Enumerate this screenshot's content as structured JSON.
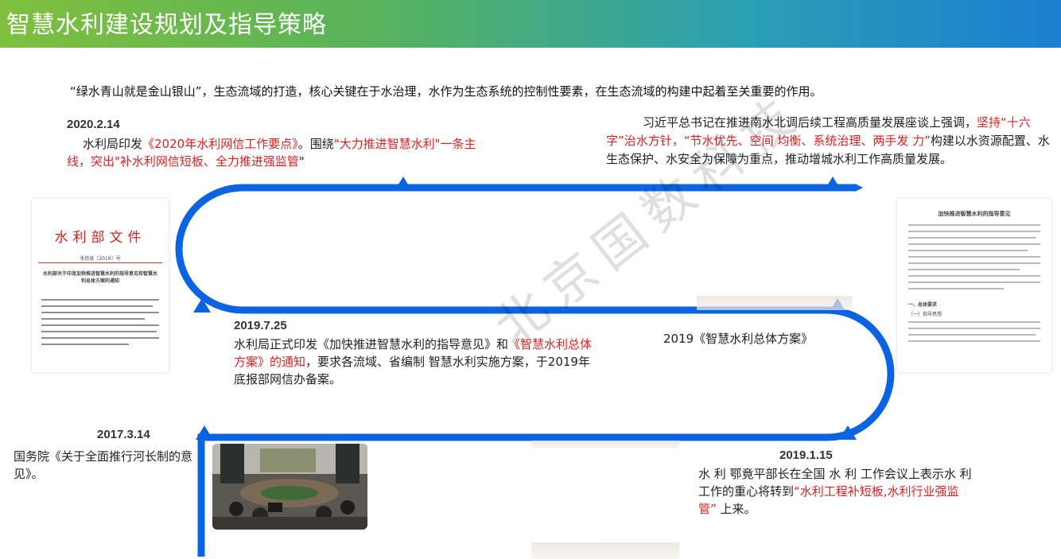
{
  "header": {
    "title": "智慧水利建设规划及指导策略"
  },
  "intro": "“绿水青山就是金山银山”，生态流域的打造，核心关键在于水治理，水作为生态系统的控制性要素，在生态流域的构建中起着至关重要的作用。",
  "events": {
    "e2020": {
      "date": "2020.2.14",
      "p1": "水利局印发",
      "r1": "《2020年水利网信工作要点》",
      "p2": "。围绕",
      "r2": "\"大力推进智慧水利\"一条主线，突出\"补水利网信短板、全力推进强监管",
      "p3": "\""
    },
    "xi": {
      "p1": "习近平总书记在推进南水北调后续工程高质量发展座谈上强调，",
      "r1": "坚持“十六字”治水方针，",
      "r2": "“节水优先、空间 均衡、系统治理、两手发 力”",
      "p2": "构建以水资源配置、水生态保护、水安全为保障为重点，推动增城水利工作高质量发展。"
    },
    "e2019_7": {
      "date": "2019.7.25",
      "p1": "水利局正式印发《加快推进智慧水利的指导意见》和",
      "r1": "《智慧水利总体方案》的通知",
      "p2": "，要求各流域、省编制 智慧水利实施方案，于2019年底报部网信办备案。"
    },
    "plan2019": "2019《智慧水利总体方案》",
    "e2017": {
      "date": "2017.3.14",
      "text": "国务院《关于全面推行河长制的意见》。"
    },
    "e2019_1": {
      "date": "2019.1.15",
      "p1": "水 利 鄂竟平部长在全国 水 利 工作会议上表示水  利  工作的重心将转到",
      "r1": "“水利工程补短板,水利行业强监管”",
      "p2": " 上来。"
    }
  },
  "docs": {
    "left": {
      "title": "水利部文件",
      "number": "水信息〔2019〕号",
      "heading": "水利部关于印发加快推进智慧水利的指导意见和智慧水利总体方案的通知"
    },
    "right": {
      "title": "加快推进智慧水利的指导意见",
      "section1": "一、总体要求",
      "section2": "（一）指导思想"
    }
  },
  "watermark": "北京国数科技",
  "colors": {
    "timeline": "#0a63e0",
    "highlight": "#e02020"
  }
}
